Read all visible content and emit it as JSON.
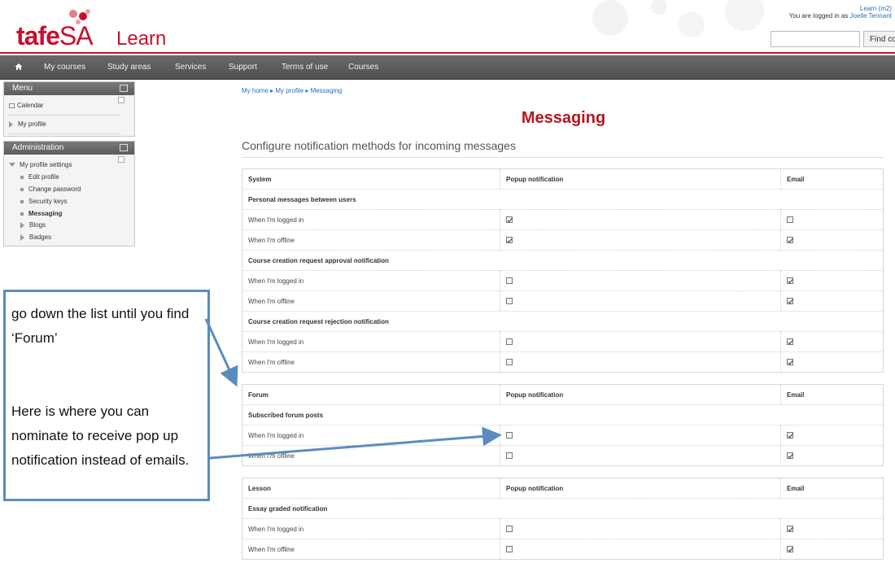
{
  "header": {
    "logo_main": "tafe",
    "logo_sa": "SA",
    "app_name": "Learn",
    "logged_in_prefix": "You are logged in as",
    "logged_in_user": "Joelle Tennant",
    "logged_in_extra": "Learn (m2)",
    "search_placeholder": "",
    "search_button": "Find co"
  },
  "nav": {
    "items": [
      "My courses",
      "Study areas",
      "Services",
      "Support",
      "Terms of use",
      "Courses"
    ]
  },
  "sidebar": {
    "menu_title": "Menu",
    "menu_items": [
      "Calendar",
      "My profile"
    ],
    "admin_title": "Administration",
    "admin_root": "My profile settings",
    "admin_items": [
      "Edit profile",
      "Change password",
      "Security keys",
      "Messaging",
      "Blogs",
      "Badges"
    ]
  },
  "breadcrumb": {
    "items": [
      "My home",
      "My profile",
      "Messaging"
    ]
  },
  "page": {
    "title": "Messaging",
    "subheading": "Configure notification methods for incoming messages"
  },
  "tables": [
    {
      "section": "System",
      "col_popup": "Popup notification",
      "col_email": "Email",
      "groups": [
        {
          "name": "Personal messages between users",
          "rows": [
            {
              "label": "When I'm logged in",
              "popup": true,
              "email": false
            },
            {
              "label": "When I'm offline",
              "popup": true,
              "email": true
            }
          ]
        },
        {
          "name": "Course creation request approval notification",
          "rows": [
            {
              "label": "When I'm logged in",
              "popup": false,
              "email": true
            },
            {
              "label": "When I'm offline",
              "popup": false,
              "email": true
            }
          ]
        },
        {
          "name": "Course creation request rejection notification",
          "rows": [
            {
              "label": "When I'm logged in",
              "popup": false,
              "email": true
            },
            {
              "label": "When I'm offline",
              "popup": false,
              "email": true
            }
          ]
        }
      ]
    },
    {
      "section": "Forum",
      "col_popup": "Popup notification",
      "col_email": "Email",
      "groups": [
        {
          "name": "Subscribed forum posts",
          "rows": [
            {
              "label": "When I'm logged in",
              "popup": false,
              "email": true
            },
            {
              "label": "When I'm offline",
              "popup": false,
              "email": true
            }
          ]
        }
      ]
    },
    {
      "section": "Lesson",
      "col_popup": "Popup notification",
      "col_email": "Email",
      "groups": [
        {
          "name": "Essay graded notification",
          "rows": [
            {
              "label": "When I'm logged in",
              "popup": false,
              "email": true
            },
            {
              "label": "When I'm offline",
              "popup": false,
              "email": true
            }
          ]
        }
      ]
    }
  ],
  "callout": {
    "line1": "go down the list until you find ‘Forum’",
    "line2": "Here is where you can nominate to receive pop up notification instead of emails."
  },
  "colors": {
    "brand_red": "#c8102e",
    "title_red": "#b5161d",
    "link_blue": "#2a6fb8",
    "callout_border": "#5b8cc0",
    "nav_bg": "#5a5a5a"
  }
}
